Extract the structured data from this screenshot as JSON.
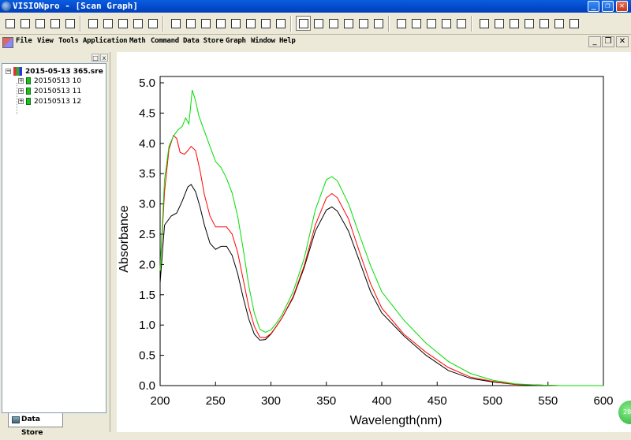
{
  "window": {
    "title": "VISIONpro - [Scan Graph]",
    "controls": [
      "_",
      "❐",
      "✕"
    ]
  },
  "toolbar": {
    "groups": [
      [
        "new-file",
        "open-file",
        "copy",
        "print-preview",
        "print"
      ],
      [
        "run-scan",
        "pause",
        "baseline",
        "hand-tool",
        "lamp"
      ],
      [
        "zoom-window",
        "export",
        "import",
        "overlay",
        "peak-pick",
        "smooth",
        "derivative",
        "grid"
      ],
      [
        "spectrum-view",
        "bar-view",
        "angle-view",
        "curve-view",
        "stack-view",
        "settings-view"
      ],
      [
        "camera",
        "cursor",
        "table-view",
        "find",
        "calculator"
      ],
      [
        "cut",
        "stats",
        "list-view",
        "sheet-view",
        "flow-view",
        "tools",
        "document"
      ]
    ],
    "pressed": [
      "spectrum-view"
    ]
  },
  "menu": {
    "items": [
      "File",
      "View",
      "Tools",
      "Application",
      "Math",
      "Command",
      "Data Store",
      "Graph",
      "Window",
      "Help"
    ]
  },
  "mdi_controls": [
    "_",
    "❐",
    "✕"
  ],
  "panel": {
    "tree": {
      "root": {
        "label": "2015-05-13 365.sre",
        "expander": "−"
      },
      "children": [
        {
          "label": "20150513 10",
          "expander": "+"
        },
        {
          "label": "20150513 11",
          "expander": "+"
        },
        {
          "label": "20150513 12",
          "expander": "+"
        }
      ]
    },
    "tab_label": "Data Store",
    "head_buttons": [
      "□",
      "x"
    ]
  },
  "badge": "28",
  "chart_data": {
    "type": "line",
    "xlabel": "Wavelength(nm)",
    "ylabel": "Absorbance",
    "xlim": [
      200,
      600
    ],
    "ylim": [
      0,
      5.0
    ],
    "xticks": [
      200,
      250,
      300,
      350,
      400,
      450,
      500,
      550,
      600
    ],
    "yticks": [
      0.0,
      0.5,
      1.0,
      1.5,
      2.0,
      2.5,
      3.0,
      3.5,
      4.0,
      4.5,
      5.0
    ],
    "xtick_labels": [
      "200",
      "250",
      "300",
      "350",
      "400",
      "450",
      "500",
      "550",
      "600"
    ],
    "ytick_labels": [
      "0.0",
      "0.5",
      "1.0",
      "1.5",
      "2.0",
      "2.5",
      "3.0",
      "3.5",
      "4.0",
      "4.5",
      "5.0"
    ],
    "grid": false,
    "series": [
      {
        "color": "#000000",
        "x": [
          200,
          204,
          210,
          215,
          220,
          225,
          228,
          232,
          236,
          240,
          245,
          250,
          255,
          260,
          265,
          270,
          275,
          280,
          285,
          290,
          295,
          300,
          305,
          310,
          320,
          330,
          340,
          350,
          355,
          360,
          370,
          380,
          390,
          400,
          420,
          440,
          460,
          480,
          500,
          520,
          540,
          560,
          580,
          600
        ],
        "y": [
          1.7,
          2.65,
          2.8,
          2.85,
          3.05,
          3.28,
          3.32,
          3.2,
          2.95,
          2.65,
          2.35,
          2.25,
          2.3,
          2.3,
          2.15,
          1.85,
          1.45,
          1.1,
          0.85,
          0.75,
          0.76,
          0.85,
          0.98,
          1.12,
          1.45,
          1.95,
          2.55,
          2.9,
          2.95,
          2.88,
          2.55,
          2.05,
          1.55,
          1.2,
          0.82,
          0.5,
          0.25,
          0.12,
          0.06,
          0.02,
          0.01,
          0.0,
          0.0,
          0.0
        ]
      },
      {
        "color": "#ff0000",
        "x": [
          200,
          204,
          208,
          212,
          215,
          218,
          222,
          225,
          228,
          232,
          236,
          240,
          245,
          250,
          255,
          260,
          265,
          270,
          275,
          280,
          285,
          290,
          295,
          300,
          305,
          310,
          320,
          330,
          340,
          350,
          355,
          360,
          370,
          380,
          390,
          400,
          420,
          440,
          460,
          480,
          500,
          520,
          540,
          560,
          580,
          600
        ],
        "y": [
          1.9,
          3.2,
          3.9,
          4.13,
          4.08,
          3.85,
          3.82,
          3.88,
          3.95,
          3.88,
          3.55,
          3.15,
          2.8,
          2.62,
          2.62,
          2.62,
          2.5,
          2.2,
          1.75,
          1.3,
          0.98,
          0.8,
          0.79,
          0.86,
          0.98,
          1.12,
          1.47,
          1.98,
          2.65,
          3.1,
          3.17,
          3.1,
          2.75,
          2.2,
          1.68,
          1.28,
          0.85,
          0.55,
          0.3,
          0.14,
          0.07,
          0.02,
          0.01,
          0.0,
          0.0,
          0.0
        ]
      },
      {
        "color": "#00dd00",
        "x": [
          200,
          204,
          208,
          212,
          216,
          220,
          223,
          226,
          229,
          232,
          235,
          240,
          245,
          250,
          255,
          260,
          265,
          270,
          275,
          280,
          285,
          290,
          295,
          300,
          305,
          310,
          320,
          330,
          340,
          350,
          355,
          360,
          370,
          380,
          390,
          400,
          420,
          440,
          460,
          480,
          500,
          520,
          540,
          560,
          580,
          600
        ],
        "y": [
          1.9,
          3.4,
          3.95,
          4.12,
          4.22,
          4.28,
          4.42,
          4.32,
          4.88,
          4.7,
          4.45,
          4.2,
          3.95,
          3.7,
          3.6,
          3.42,
          3.18,
          2.8,
          2.25,
          1.65,
          1.2,
          0.93,
          0.88,
          0.92,
          1.03,
          1.17,
          1.55,
          2.1,
          2.9,
          3.4,
          3.45,
          3.38,
          3.0,
          2.48,
          1.98,
          1.55,
          1.08,
          0.7,
          0.4,
          0.2,
          0.09,
          0.03,
          0.01,
          0.0,
          0.0,
          0.0
        ]
      }
    ]
  }
}
